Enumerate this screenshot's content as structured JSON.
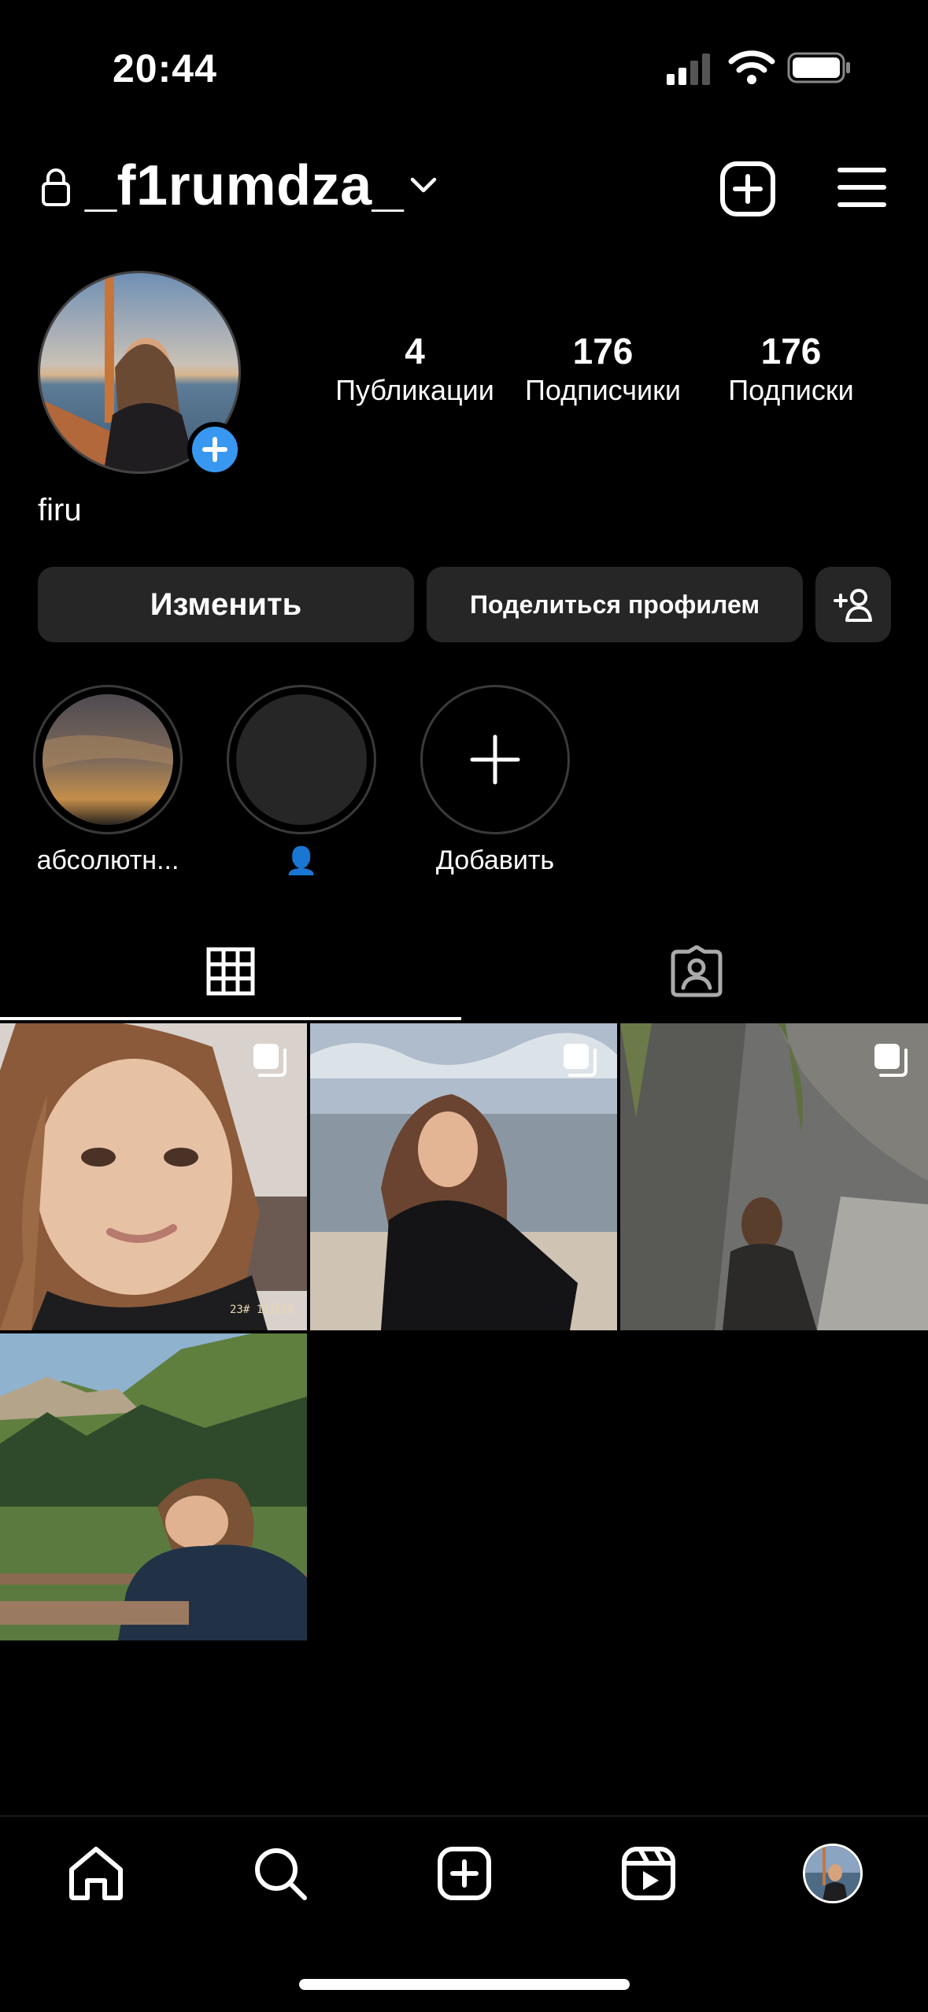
{
  "status_bar": {
    "time": "20:44",
    "icons": [
      "cellular-signal-icon",
      "wifi-icon",
      "battery-icon"
    ]
  },
  "header": {
    "username": "_f1rumdza_",
    "icons": {
      "lock": "lock-icon",
      "dropdown": "chevron-down-icon",
      "new_post": "plus-square-icon",
      "menu": "hamburger-menu-icon"
    }
  },
  "profile": {
    "display_name": "firu",
    "stats": [
      {
        "value": "4",
        "label": "Публикации"
      },
      {
        "value": "176",
        "label": "Подписчики"
      },
      {
        "value": "176",
        "label": "Подписки"
      }
    ]
  },
  "actions": {
    "edit_label": "Изменить",
    "share_label": "Поделиться профилем",
    "suggest_icon": "add-person-icon"
  },
  "highlights": [
    {
      "label": "абсолютн..."
    },
    {
      "label": "👤"
    },
    {
      "label": "Добавить"
    }
  ],
  "tabs": [
    {
      "icon": "grid-icon"
    },
    {
      "icon": "tagged-person-icon"
    }
  ],
  "posts": [
    {
      "overlay": "23# 11月18",
      "carousel": true
    },
    {
      "overlay": "",
      "carousel": true
    },
    {
      "overlay": "",
      "carousel": true
    },
    {
      "overlay": "",
      "carousel": false
    }
  ],
  "bottom_nav": [
    "home-icon",
    "search-icon",
    "create-icon",
    "reels-icon",
    "profile-avatar"
  ],
  "colors": {
    "background": "#000000",
    "button": "#262626",
    "accent": "#3897f0",
    "text": "#ffffff"
  }
}
